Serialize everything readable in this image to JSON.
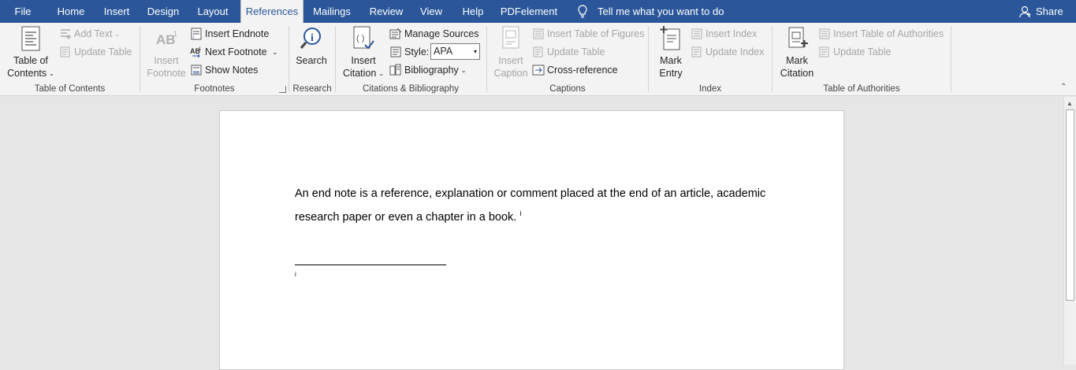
{
  "tabs": [
    {
      "label": "File"
    },
    {
      "label": "Home"
    },
    {
      "label": "Insert"
    },
    {
      "label": "Design"
    },
    {
      "label": "Layout"
    },
    {
      "label": "References",
      "active": true
    },
    {
      "label": "Mailings"
    },
    {
      "label": "Review"
    },
    {
      "label": "View"
    },
    {
      "label": "Help"
    },
    {
      "label": "PDFelement"
    }
  ],
  "tell_me": "Tell me what you want to do",
  "share": "Share",
  "groups": {
    "toc": {
      "label": "Table of Contents",
      "toc_button": [
        "Table of",
        "Contents"
      ],
      "add_text": "Add Text",
      "update_table": "Update Table"
    },
    "footnotes": {
      "label": "Footnotes",
      "insert_footnote": [
        "Insert",
        "Footnote"
      ],
      "insert_endnote": "Insert Endnote",
      "next_footnote": "Next Footnote",
      "show_notes": "Show Notes",
      "ab_glyph": "AB"
    },
    "research": {
      "label": "Research",
      "search": "Search"
    },
    "citations": {
      "label": "Citations & Bibliography",
      "insert_citation": [
        "Insert",
        "Citation"
      ],
      "manage_sources": "Manage Sources",
      "style_label": "Style:",
      "style_value": "APA",
      "bibliography": "Bibliography"
    },
    "captions": {
      "label": "Captions",
      "insert_caption": [
        "Insert",
        "Caption"
      ],
      "insert_table_of_figures": "Insert Table of Figures",
      "update_table": "Update Table",
      "cross_reference": "Cross-reference"
    },
    "index": {
      "label": "Index",
      "mark_entry": [
        "Mark",
        "Entry"
      ],
      "insert_index": "Insert Index",
      "update_index": "Update Index"
    },
    "toa": {
      "label": "Table of Authorities",
      "mark_citation": [
        "Mark",
        "Citation"
      ],
      "insert_toa": "Insert Table of Authorities",
      "update_table": "Update Table"
    }
  },
  "document": {
    "line1": "An end note is a reference, explanation or comment placed at the end of an article, academic",
    "line2": "research paper or even a chapter in a book.",
    "endnote_ref": "i",
    "endnote_mark": "i"
  },
  "colors": {
    "title_bar": "#2b579a",
    "ribbon": "#f3f3f3",
    "canvas": "#e6e6e6"
  }
}
